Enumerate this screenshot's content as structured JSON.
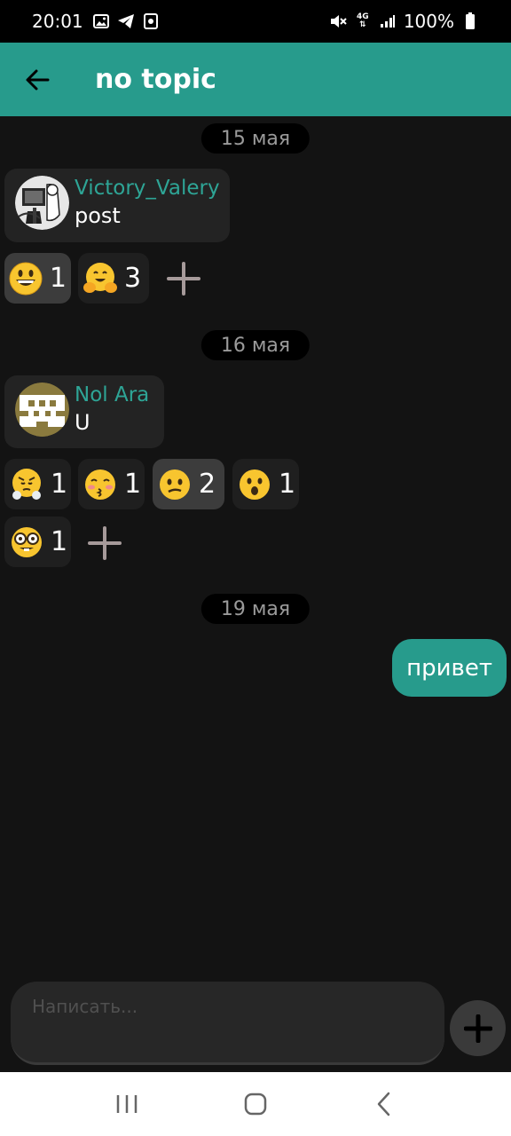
{
  "status_bar": {
    "time": "20:01",
    "network": "4G",
    "battery": "100%",
    "left_icons": [
      "image-icon",
      "telegram-icon",
      "app-icon"
    ],
    "right_icons": [
      "mute-icon",
      "4g-icon",
      "signal-icon",
      "battery-icon"
    ]
  },
  "app_bar": {
    "back_icon": "arrow-back-icon",
    "title": "no topic",
    "color": "#279b8c"
  },
  "messages": [
    {
      "date": "15 мая",
      "author": "Victory_Valery",
      "text": "post",
      "reactions": [
        {
          "emoji": "grinning-face",
          "count": "1",
          "active": true
        },
        {
          "emoji": "hugging-face",
          "count": "3",
          "active": false
        }
      ]
    },
    {
      "date": "16 мая",
      "author": "Nol Ara",
      "text": "U",
      "reactions": [
        {
          "emoji": "steam-from-nose-face",
          "count": "1",
          "active": false
        },
        {
          "emoji": "kissing-closed-eyes-face",
          "count": "1",
          "active": false
        },
        {
          "emoji": "confused-face",
          "count": "2",
          "active": true
        },
        {
          "emoji": "hushed-face",
          "count": "1",
          "active": false
        },
        {
          "emoji": "nerd-face",
          "count": "1",
          "active": false
        }
      ]
    }
  ],
  "outgoing": {
    "date": "19 мая",
    "text": "привет"
  },
  "composer": {
    "placeholder": "Написать..."
  },
  "nav_bar": {
    "icons": [
      "recent-apps-icon",
      "home-icon",
      "back-icon"
    ]
  }
}
